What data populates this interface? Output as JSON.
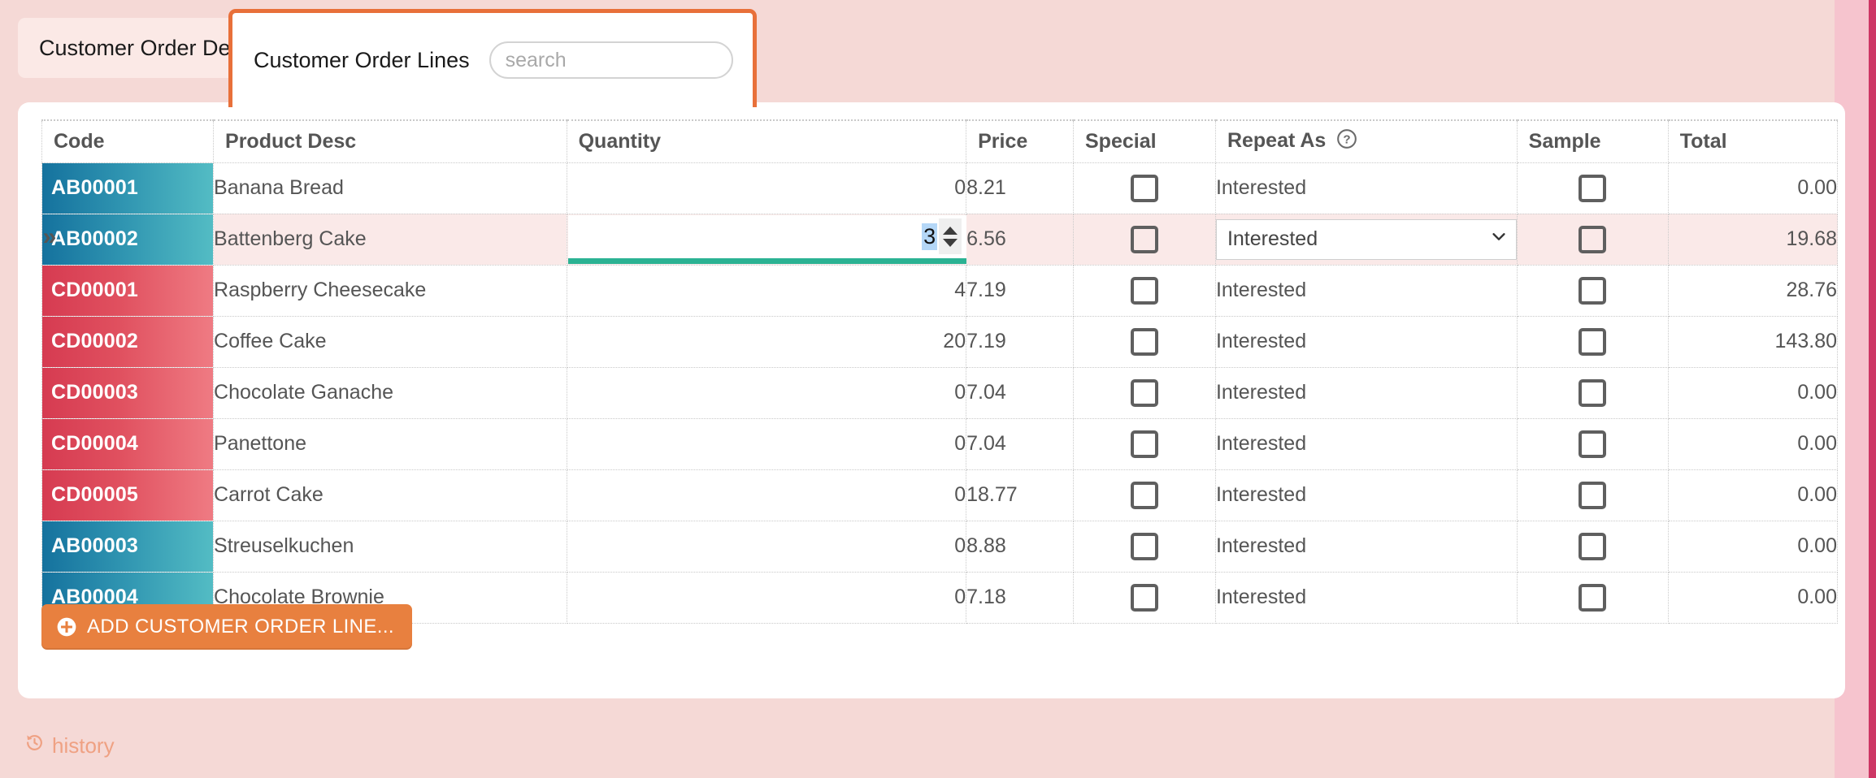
{
  "tabs": {
    "details": {
      "label": "Customer Order Details",
      "icon": "refresh-icon"
    },
    "lines": {
      "label": "Customer Order Lines"
    }
  },
  "search": {
    "placeholder": "search",
    "value": ""
  },
  "table": {
    "headers": {
      "code": "Code",
      "product_desc": "Product Desc",
      "quantity": "Quantity",
      "price": "Price",
      "special": "Special",
      "repeat_as": "Repeat As",
      "repeat_as_help": "?",
      "sample": "Sample",
      "total": "Total"
    },
    "rows": [
      {
        "code": "AB00001",
        "code_color": "teal",
        "desc": "Banana Bread",
        "qty": "0",
        "price": "8.21",
        "special": false,
        "repeat": "Interested",
        "sample": false,
        "total": "0.00",
        "selected": false
      },
      {
        "code": "AB00002",
        "code_color": "teal",
        "desc": "Battenberg Cake",
        "qty": "3",
        "price": "6.56",
        "special": false,
        "repeat": "Interested",
        "sample": false,
        "total": "19.68",
        "selected": true
      },
      {
        "code": "CD00001",
        "code_color": "red",
        "desc": "Raspberry Cheesecake",
        "qty": "4",
        "price": "7.19",
        "special": false,
        "repeat": "Interested",
        "sample": false,
        "total": "28.76",
        "selected": false
      },
      {
        "code": "CD00002",
        "code_color": "red",
        "desc": "Coffee Cake",
        "qty": "20",
        "price": "7.19",
        "special": false,
        "repeat": "Interested",
        "sample": false,
        "total": "143.80",
        "selected": false
      },
      {
        "code": "CD00003",
        "code_color": "red",
        "desc": "Chocolate Ganache",
        "qty": "0",
        "price": "7.04",
        "special": false,
        "repeat": "Interested",
        "sample": false,
        "total": "0.00",
        "selected": false
      },
      {
        "code": "CD00004",
        "code_color": "red",
        "desc": "Panettone",
        "qty": "0",
        "price": "7.04",
        "special": false,
        "repeat": "Interested",
        "sample": false,
        "total": "0.00",
        "selected": false
      },
      {
        "code": "CD00005",
        "code_color": "red",
        "desc": "Carrot Cake",
        "qty": "0",
        "price": "18.77",
        "special": false,
        "repeat": "Interested",
        "sample": false,
        "total": "0.00",
        "selected": false
      },
      {
        "code": "AB00003",
        "code_color": "teal",
        "desc": "Streuselkuchen",
        "qty": "0",
        "price": "8.88",
        "special": false,
        "repeat": "Interested",
        "sample": false,
        "total": "0.00",
        "selected": false
      },
      {
        "code": "AB00004",
        "code_color": "teal",
        "desc": "Chocolate Brownie",
        "qty": "0",
        "price": "7.18",
        "special": false,
        "repeat": "Interested",
        "sample": false,
        "total": "0.00",
        "selected": false
      }
    ],
    "selected_row_index": 1,
    "expander_glyph": "»",
    "editing": {
      "quantity_value": "3",
      "repeat_selected": "Interested",
      "repeat_options": [
        "Interested"
      ]
    }
  },
  "actions": {
    "add_line_label": "ADD CUSTOMER ORDER LINE...",
    "add_line_icon": "plus-circle-icon",
    "history_label": "history",
    "history_icon": "history-icon"
  },
  "colors": {
    "page_background": "#f5d9d6",
    "accent_orange": "#e8803f",
    "selected_row": "#fae9e8",
    "edit_underline": "#2bb293",
    "text_selection": "#b4d7f7",
    "code_teal_from": "#15729e",
    "code_teal_to": "#53bcc4",
    "code_red_from": "#d63b51",
    "code_red_to": "#ef7b83",
    "history_link": "#efa183",
    "right_edge": "#c9295b"
  }
}
